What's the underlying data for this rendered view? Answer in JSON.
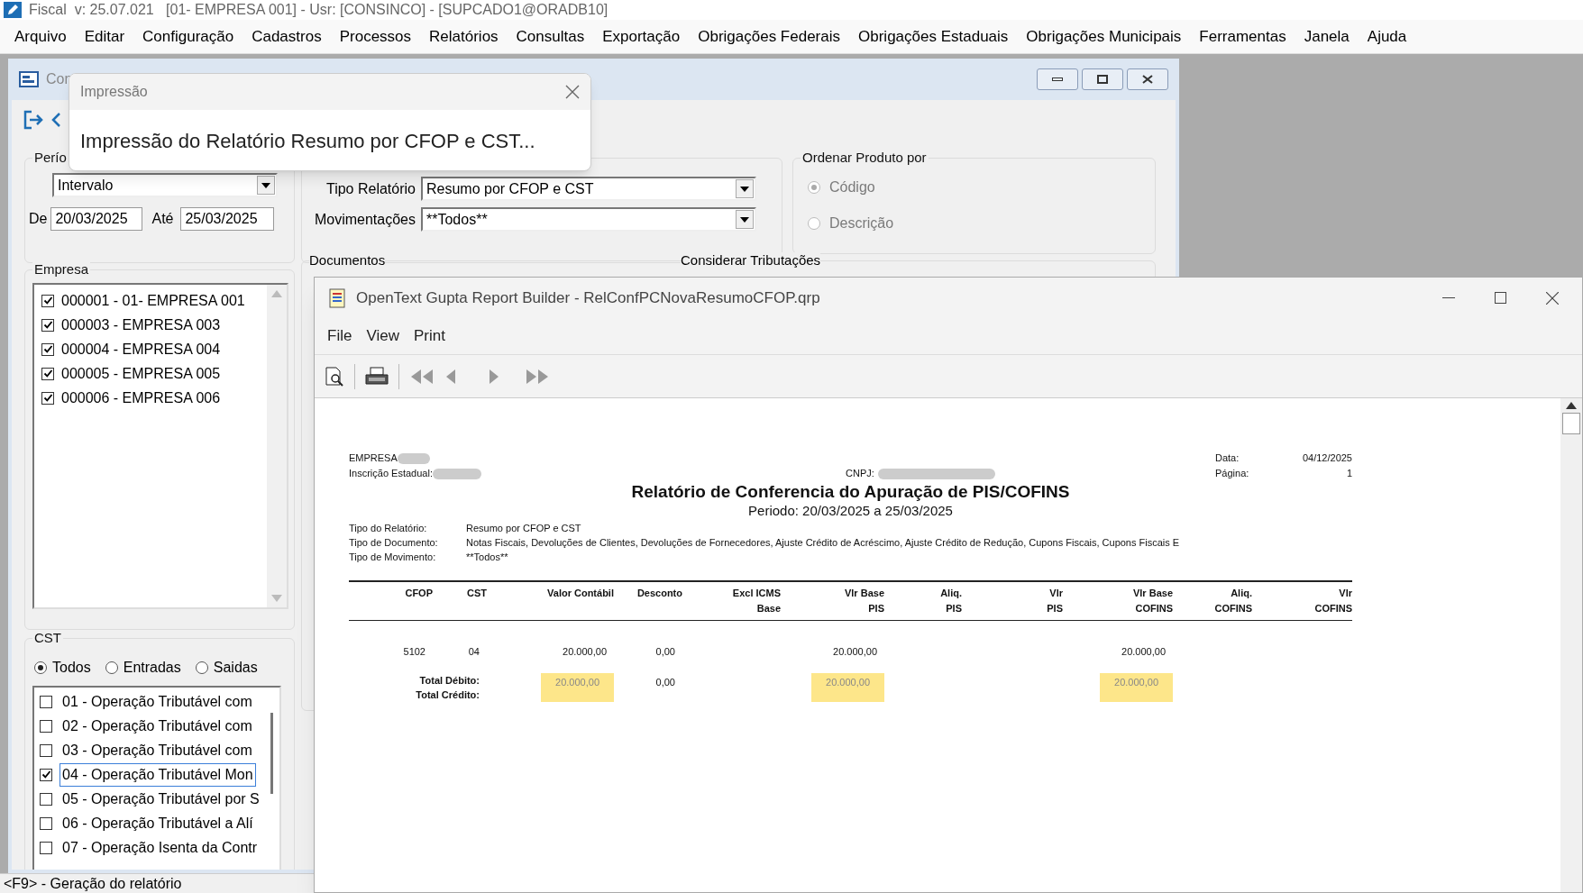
{
  "app_window": {
    "title": "Fiscal  v: 25.07.021   [01- EMPRESA 001] - Usr: [CONSINCO] - [SUPCADO1@ORADB10]"
  },
  "menu": [
    "Arquivo",
    "Editar",
    "Configuração",
    "Cadastros",
    "Processos",
    "Relatórios",
    "Consultas",
    "Exportação",
    "Obrigações Federais",
    "Obrigações Estaduais",
    "Obrigações Municipais",
    "Ferramentas",
    "Janela",
    "Ajuda"
  ],
  "form": {
    "title": "Con",
    "period": {
      "legend": "Perío",
      "mode": "Intervalo",
      "from_label": "De",
      "from": "20/03/2025",
      "to_label": "Até",
      "to": "25/03/2025"
    },
    "report": {
      "type_label": "Tipo Relatório",
      "type": "Resumo por CFOP e CST",
      "mov_label": "Movimentações",
      "mov": "**Todos**"
    },
    "order": {
      "legend": "Ordenar Produto por",
      "disabled": true,
      "options": [
        {
          "label": "Código",
          "selected": true
        },
        {
          "label": "Descrição",
          "selected": false
        }
      ]
    },
    "empresa": {
      "legend": "Empresa",
      "items": [
        {
          "label": "000001 - 01- EMPRESA 001",
          "checked": true
        },
        {
          "label": "000003 - EMPRESA 003",
          "checked": true
        },
        {
          "label": "000004 - EMPRESA 004",
          "checked": true
        },
        {
          "label": "000005 - EMPRESA 005",
          "checked": true
        },
        {
          "label": "000006 - EMPRESA 006",
          "checked": true
        }
      ]
    },
    "cst": {
      "legend": "CST",
      "filters": [
        {
          "label": "Todos",
          "selected": true
        },
        {
          "label": "Entradas",
          "selected": false
        },
        {
          "label": "Saidas",
          "selected": false
        }
      ],
      "items": [
        {
          "label": "01 - Operação Tributável com",
          "checked": false,
          "focused": false
        },
        {
          "label": "02 - Operação Tributável com",
          "checked": false,
          "focused": false
        },
        {
          "label": "03 - Operação Tributável com",
          "checked": false,
          "focused": false
        },
        {
          "label": "04 - Operação Tributável Mon",
          "checked": true,
          "focused": true
        },
        {
          "label": "05 - Operação Tributável por S",
          "checked": false,
          "focused": false
        },
        {
          "label": "06 - Operação Tributável a Alí",
          "checked": false,
          "focused": false
        },
        {
          "label": "07 - Operação Isenta da Contr",
          "checked": false,
          "focused": false
        }
      ]
    },
    "partial_legends": [
      "Documentos",
      "Considerar Tributações"
    ]
  },
  "status_bar": "<F9> - Geração do relatório",
  "dialog": {
    "title": "Impressão",
    "message": "Impressão do Relatório Resumo por CFOP e CST..."
  },
  "viewer": {
    "title": "OpenText Gupta Report Builder - RelConfPCNovaResumoCFOP.qrp",
    "menu": [
      "File",
      "View",
      "Print"
    ],
    "report": {
      "empresa_label": "EMPRESA",
      "ie_label": "Inscrição Estadual:",
      "cnpj_label": "CNPJ:",
      "meta": [
        {
          "label": "Data:",
          "value": "04/12/2025"
        },
        {
          "label": "Página:",
          "value": "1"
        }
      ],
      "title": "Relatório de Conferencia do Apuração de PIS/COFINS",
      "period": "Periodo: 20/03/2025 a 25/03/2025",
      "params": [
        {
          "label": "Tipo do Relatório:",
          "value": "Resumo por CFOP e CST"
        },
        {
          "label": "Tipo de Documento:",
          "value": "Notas Fiscais, Devoluções de Clientes, Devoluções de Fornecedores, Ajuste Crédito de Acréscimo, Ajuste Crédito de Redução, Cupons Fiscais, Cupons Fiscais E"
        },
        {
          "label": "Tipo de Movimento:",
          "value": "**Todos**"
        }
      ],
      "columns": [
        {
          "line1": "CFOP"
        },
        {
          "line1": "CST"
        },
        {
          "line1": "Valor Contábil",
          "total": {
            "text": "20.000,00",
            "highlighted": true
          }
        },
        {
          "line1": "Desconto",
          "total": {
            "text": "0,00",
            "highlighted": false
          }
        },
        {
          "line1": "Excl ICMS",
          "line2": "Base"
        },
        {
          "line1": "Vlr Base",
          "line2": "PIS",
          "total": {
            "text": "20.000,00",
            "highlighted": true
          }
        },
        {
          "line1": "Aliq.",
          "line2": "PIS"
        },
        {
          "line1": "Vlr",
          "line2": "PIS"
        },
        {
          "line1": "Vlr Base",
          "line2": "COFINS",
          "total": {
            "text": "20.000,00",
            "highlighted": true
          }
        },
        {
          "line1": "Aliq.",
          "line2": "COFINS"
        },
        {
          "line1": "Vlr",
          "line2": "COFINS"
        }
      ],
      "rows": [
        {
          "cells": [
            "5102",
            "04",
            "20.000,00",
            "0,00",
            null,
            "20.000,00",
            null,
            null,
            "20.000,00",
            null,
            null
          ]
        }
      ],
      "totals": {
        "debit_label": "Total Débito:",
        "credit_label": "Total Crédito:"
      }
    }
  }
}
